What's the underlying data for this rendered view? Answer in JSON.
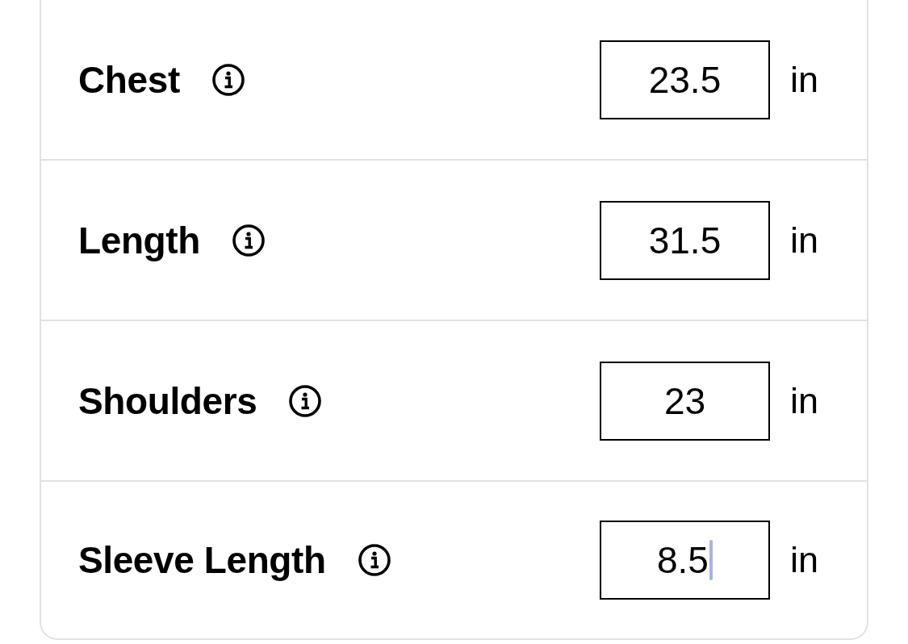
{
  "rows": [
    {
      "label": "Chest",
      "value": "23.5",
      "unit": "in",
      "focused": false
    },
    {
      "label": "Length",
      "value": "31.5",
      "unit": "in",
      "focused": false
    },
    {
      "label": "Shoulders",
      "value": "23",
      "unit": "in",
      "focused": false
    },
    {
      "label": "Sleeve Length",
      "value": "8.5",
      "unit": "in",
      "focused": true
    }
  ]
}
